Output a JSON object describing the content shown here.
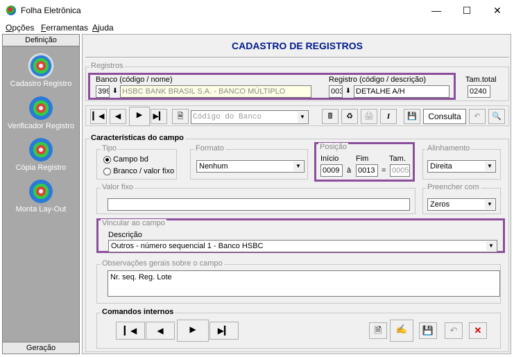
{
  "window": {
    "title": "Folha Eletrônica",
    "minimize": "—",
    "maximize": "☐",
    "close": "✕"
  },
  "menu": [
    {
      "label": "Opções",
      "u": "O",
      "rest": "pções"
    },
    {
      "label": "Ferramentas",
      "u": "F",
      "rest": "erramentas"
    },
    {
      "label": "Ajuda",
      "u": "A",
      "rest": "juda"
    }
  ],
  "sidebar": {
    "header": "Definição",
    "footer": "Geração",
    "items": [
      {
        "label": "Cadastro Registro"
      },
      {
        "label": "Verificador Registro"
      },
      {
        "label": "Cópia Registro"
      },
      {
        "label": "Monta Lay-Out"
      }
    ]
  },
  "page": {
    "title": "CADASTRO DE REGISTROS"
  },
  "registros": {
    "group_label": "Registros",
    "banco_label": "Banco (código / nome)",
    "banco_code": "399",
    "banco_name": "HSBC BANK BRASIL S.A. - BANCO MÚLTIPLO",
    "registro_label": "Registro (código / descrição)",
    "registro_code": "003",
    "registro_desc": "DETALHE A/H",
    "tam_label": "Tam.total",
    "tam_value": "0240"
  },
  "toolbar": {
    "search_placeholder": "Código do Banco",
    "consulta_label": "Consulta"
  },
  "caracteristicas": {
    "group_label": "Características do campo",
    "tipo": {
      "label": "Tipo",
      "opt1": "Campo bd",
      "opt2": "Branco / valor fixo"
    },
    "formato": {
      "label": "Formato",
      "value": "Nenhum"
    },
    "posicao": {
      "label": "Posição",
      "inicio_label": "Início",
      "fim_label": "Fim",
      "tam_label": "Tam.",
      "inicio": "0009",
      "sep_a": "à",
      "fim": "0013",
      "sep_eq": "=",
      "tam": "0005"
    },
    "alinhamento": {
      "label": "Alinhamento",
      "value": "Direita"
    },
    "valor_fixo": {
      "label": "Valor fixo",
      "value": ""
    },
    "preencher": {
      "label": "Preencher com",
      "value": "Zeros"
    },
    "vincular": {
      "label": "Vincular ao campo",
      "desc_label": "Descrição",
      "value": "Outros - número sequencial 1 - Banco HSBC"
    },
    "observacoes": {
      "label": "Observações gerais sobre o campo",
      "value": "Nr. seq. Reg. Lote"
    }
  },
  "comandos": {
    "label": "Comandos internos"
  }
}
